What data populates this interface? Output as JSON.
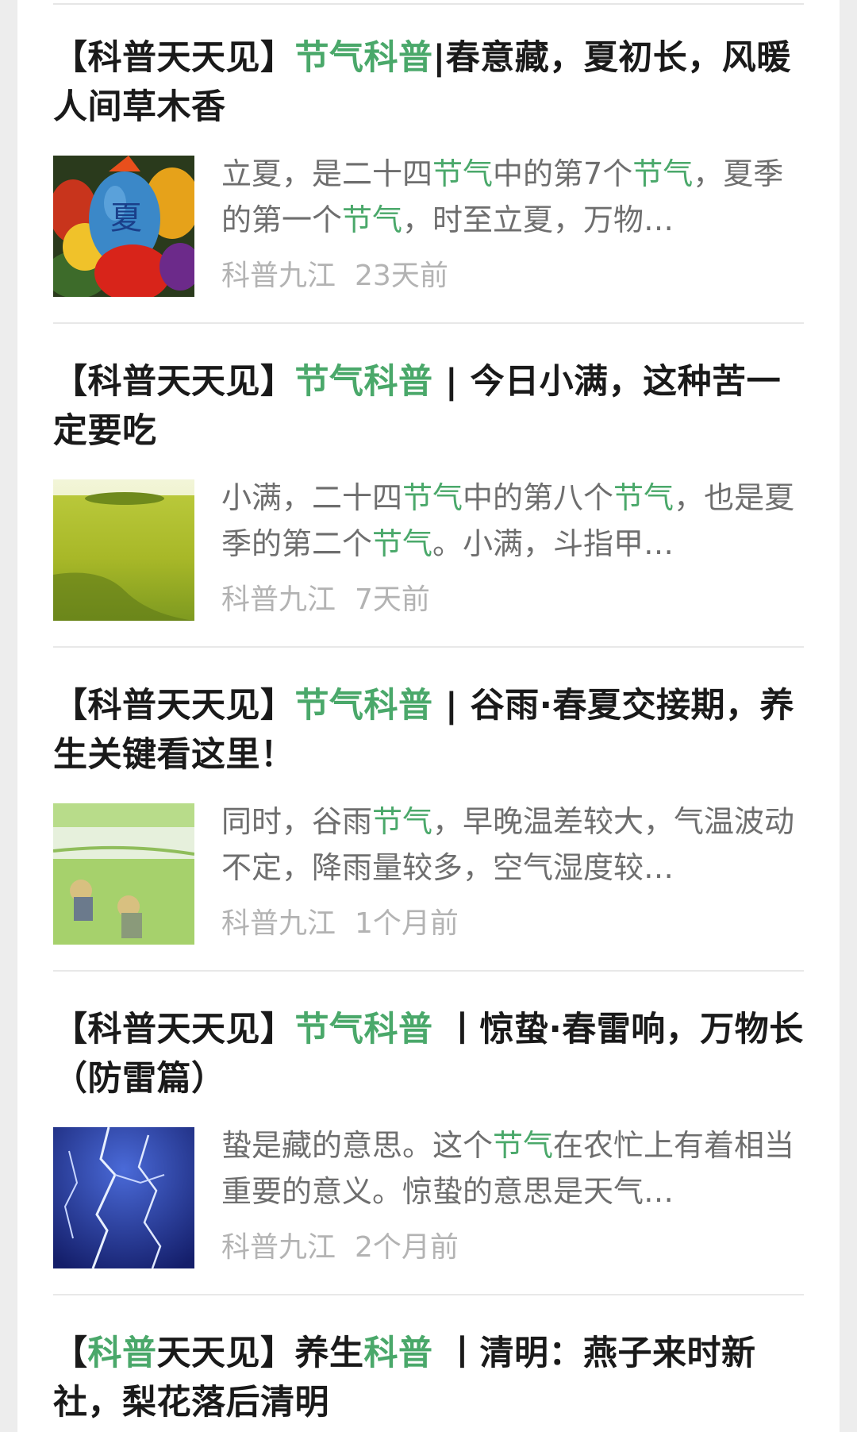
{
  "colors": {
    "highlight": "#4aa86a",
    "title": "#1a1a1a",
    "summary": "#6e6e6e",
    "meta": "#b3b3b3"
  },
  "articles": [
    {
      "title_segments": [
        {
          "text": "【科普天天见】",
          "hl": false
        },
        {
          "text": "节气科普",
          "hl": true
        },
        {
          "text": "|春意藏，夏初长，风暖人间草木香",
          "hl": false
        }
      ],
      "summary_segments": [
        {
          "text": "立夏，是二十四",
          "hl": false
        },
        {
          "text": "节气",
          "hl": true
        },
        {
          "text": "中的第7个",
          "hl": false
        },
        {
          "text": "节气",
          "hl": true
        },
        {
          "text": "，夏季的第一个",
          "hl": false
        },
        {
          "text": "节气",
          "hl": true
        },
        {
          "text": "，时至立夏，万物…",
          "hl": false
        }
      ],
      "thumb_icon": "painted-eggs-image",
      "source": "科普九江",
      "time": "23天前"
    },
    {
      "title_segments": [
        {
          "text": "【科普天天见】",
          "hl": false
        },
        {
          "text": "节气科普",
          "hl": true
        },
        {
          "text": " | 今日小满，这种苦一定要吃",
          "hl": false
        }
      ],
      "summary_segments": [
        {
          "text": "小满，二十四",
          "hl": false
        },
        {
          "text": "节气",
          "hl": true
        },
        {
          "text": "中的第八个",
          "hl": false
        },
        {
          "text": "节气",
          "hl": true
        },
        {
          "text": "，也是夏季的第二个",
          "hl": false
        },
        {
          "text": "节气",
          "hl": true
        },
        {
          "text": "。小满，斗指甲…",
          "hl": false
        }
      ],
      "thumb_icon": "wheat-field-image",
      "source": "科普九江",
      "time": "7天前"
    },
    {
      "title_segments": [
        {
          "text": "【科普天天见】",
          "hl": false
        },
        {
          "text": "节气科普",
          "hl": true
        },
        {
          "text": " | 谷雨·春夏交接期，养生关键看这里！",
          "hl": false
        }
      ],
      "summary_segments": [
        {
          "text": "同时，谷雨",
          "hl": false
        },
        {
          "text": "节气",
          "hl": true
        },
        {
          "text": "，早晚温差较大，气温波动不定，降雨量较多，空气湿度较…",
          "hl": false
        }
      ],
      "thumb_icon": "rice-planting-image",
      "source": "科普九江",
      "time": "1个月前"
    },
    {
      "title_segments": [
        {
          "text": "【科普天天见】",
          "hl": false
        },
        {
          "text": "节气科普",
          "hl": true
        },
        {
          "text": " 丨惊蛰·春雷响，万物长（防雷篇）",
          "hl": false
        }
      ],
      "summary_segments": [
        {
          "text": "蛰是藏的意思。这个",
          "hl": false
        },
        {
          "text": "节气",
          "hl": true
        },
        {
          "text": "在农忙上有着相当重要的意义。惊蛰的意思是天气…",
          "hl": false
        }
      ],
      "thumb_icon": "lightning-image",
      "source": "科普九江",
      "time": "2个月前"
    },
    {
      "title_segments": [
        {
          "text": "【",
          "hl": false
        },
        {
          "text": "科普",
          "hl": true
        },
        {
          "text": "天天见】养生",
          "hl": false
        },
        {
          "text": "科普",
          "hl": true
        },
        {
          "text": " 丨清明：燕子来时新社，梨花落后清明",
          "hl": false
        }
      ],
      "summary_segments": [],
      "thumb_icon": "",
      "source": "",
      "time": ""
    }
  ]
}
